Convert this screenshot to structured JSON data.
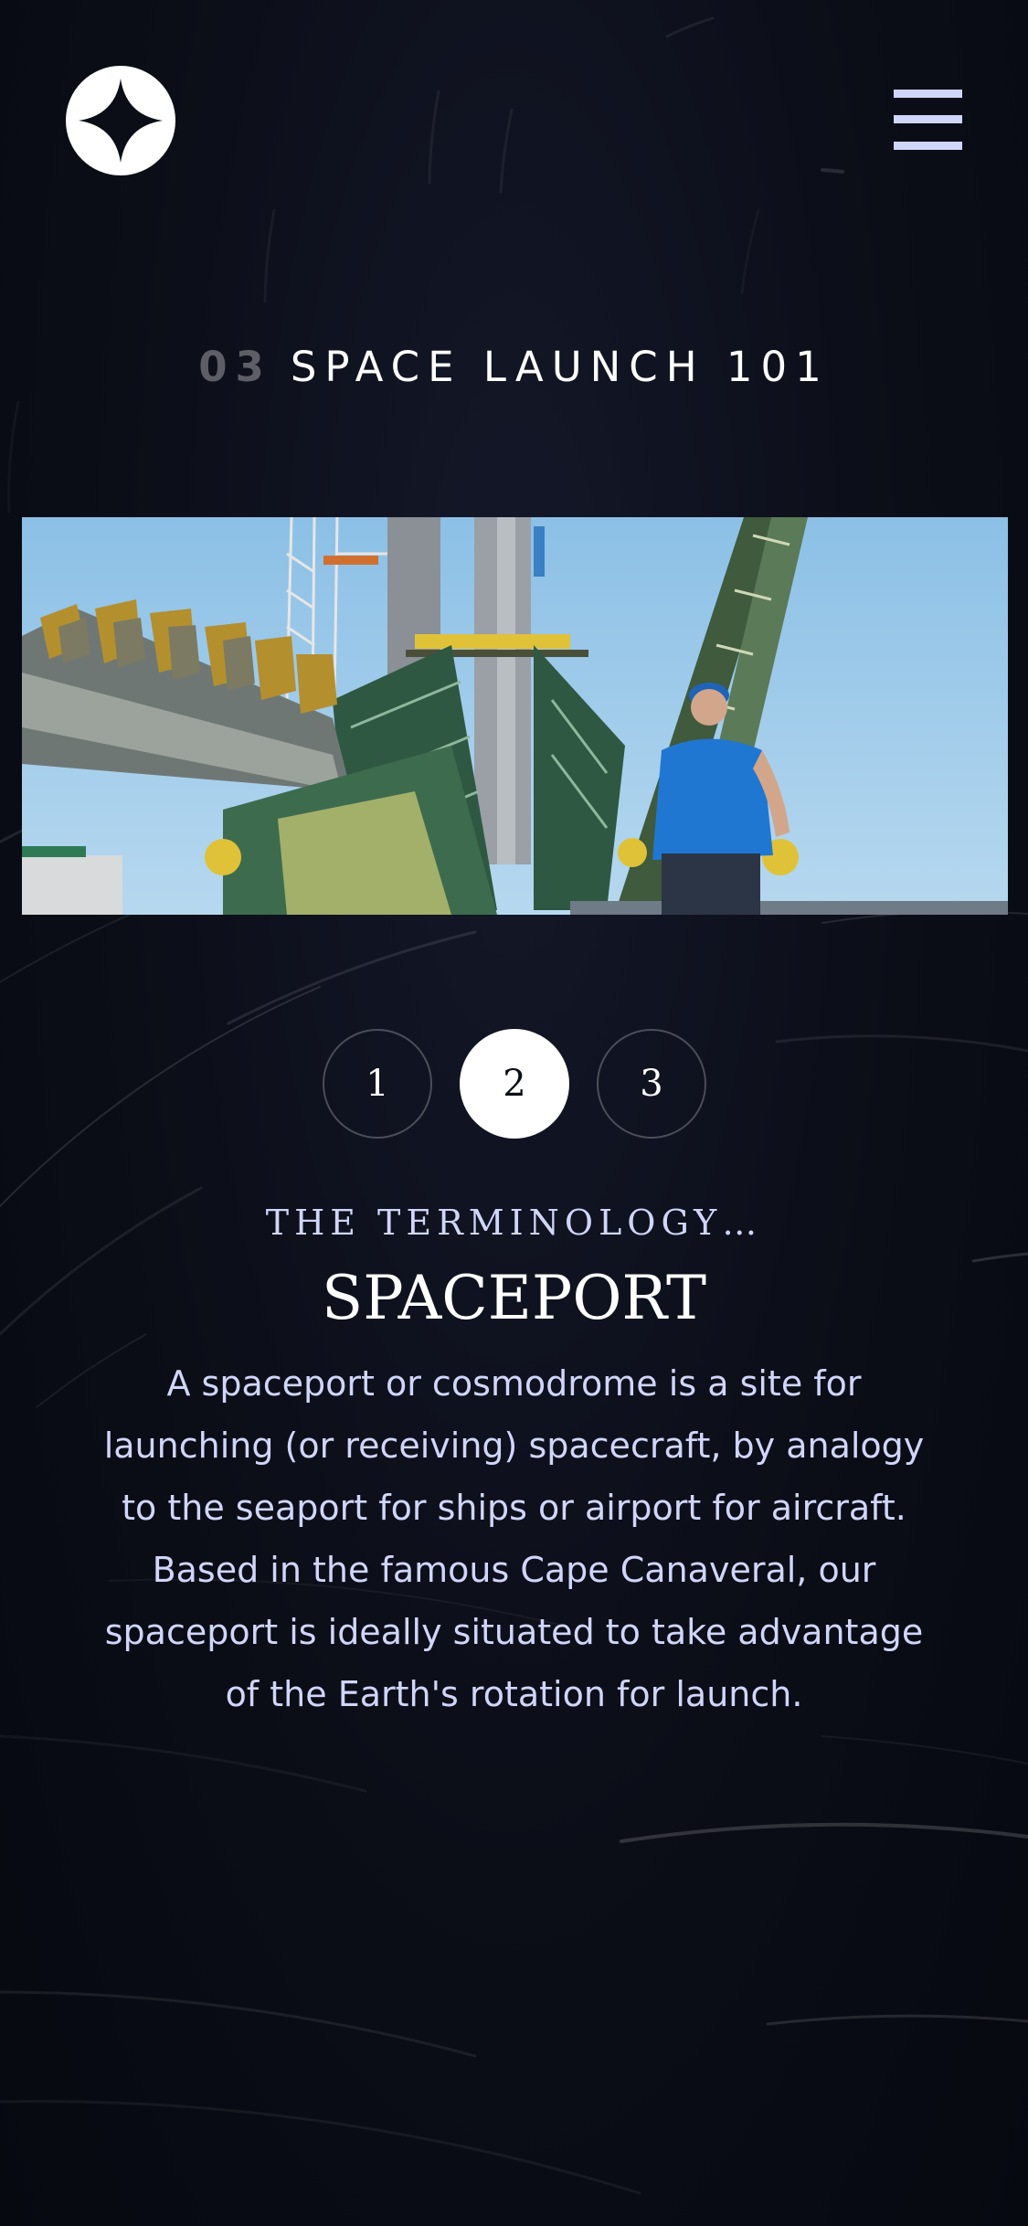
{
  "header": {
    "logo_icon": "star-logo-icon",
    "menu_icon": "hamburger-menu-icon"
  },
  "page": {
    "number": "03",
    "title": "SPACE LAUNCH 101"
  },
  "image": {
    "subject": "launch-pad-photo"
  },
  "tabs": [
    {
      "label": "1",
      "active": false
    },
    {
      "label": "2",
      "active": true
    },
    {
      "label": "3",
      "active": false
    }
  ],
  "content": {
    "subheading": "THE TERMINOLOGY…",
    "title": "SPACEPORT",
    "description": "A spaceport or cosmodrome is a site for launching (or receiving) spacecraft, by analogy to the seaport for ships or airport for aircraft. Based in the famous Cape Canaveral, our spaceport is ideally situated to take advantage of the Earth's rotation for launch."
  },
  "colors": {
    "background": "#0b0d17",
    "accent": "#d0d6f9",
    "white": "#ffffff",
    "muted": "#5d5e66"
  }
}
